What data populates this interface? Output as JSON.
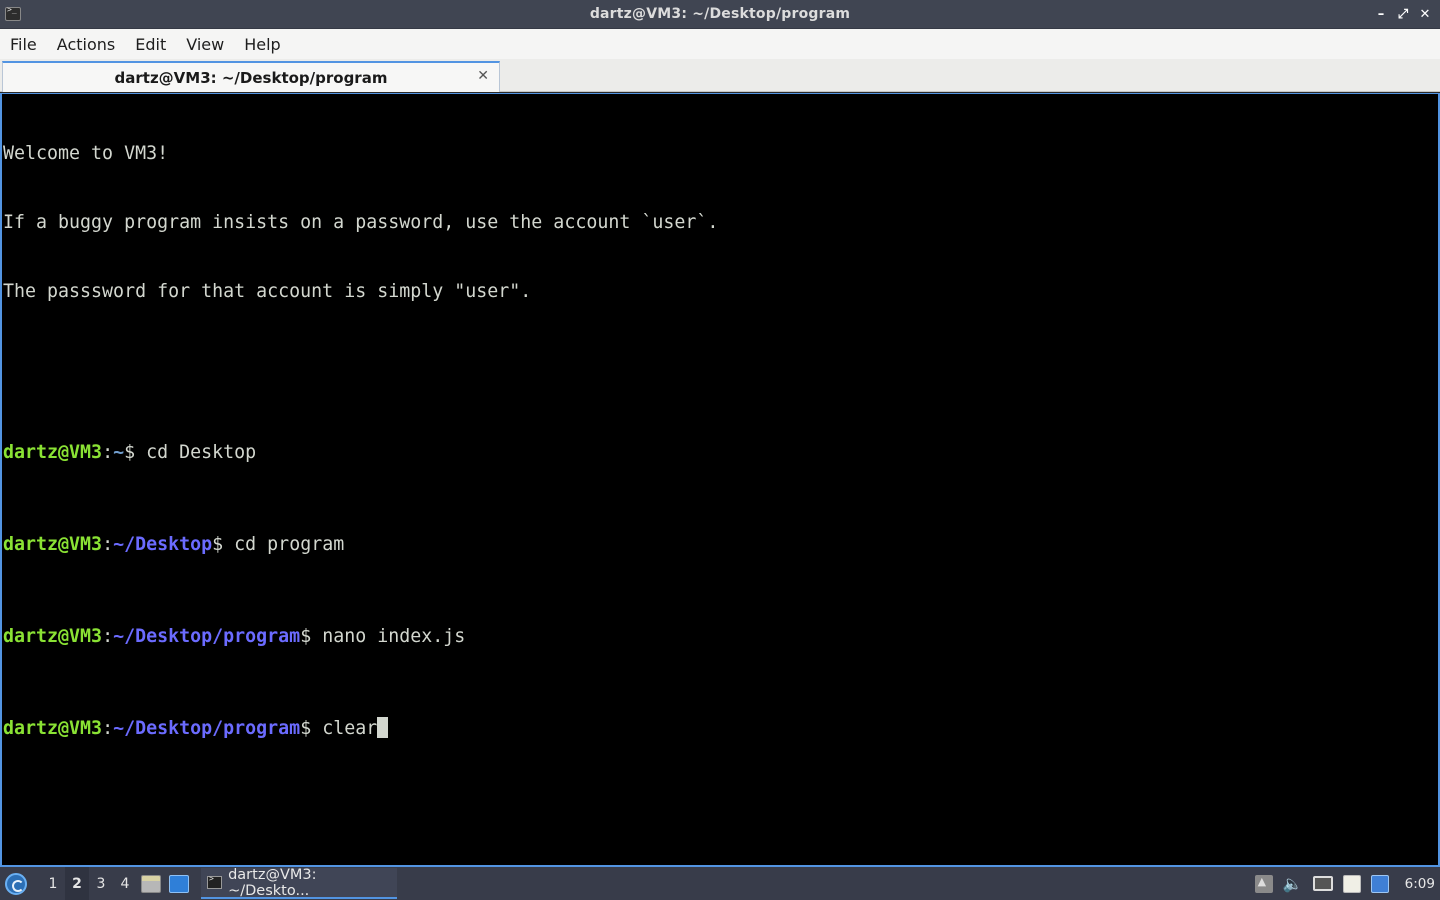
{
  "window": {
    "title": "dartz@VM3: ~/Desktop/program",
    "minimize_glyph": "–",
    "maximize_glyph": "⤢",
    "close_glyph": "✕"
  },
  "menu": {
    "items": [
      "File",
      "Actions",
      "Edit",
      "View",
      "Help"
    ]
  },
  "tabs": [
    {
      "label": "dartz@VM3: ~/Desktop/program",
      "close_glyph": "✕"
    }
  ],
  "terminal": {
    "motd": [
      "Welcome to VM3!",
      "If a buggy program insists on a password, use the account `user`.",
      "The passsword for that account is simply \"user\"."
    ],
    "prompt_user": "dartz@VM3",
    "prompt_sep": ":",
    "commands": [
      {
        "path": "~",
        "cmd": " cd Desktop"
      },
      {
        "path": "~/Desktop",
        "cmd": " cd program"
      },
      {
        "path": "~/Desktop/program",
        "cmd": " nano index.js"
      },
      {
        "path": "~/Desktop/program",
        "cmd": " clear"
      }
    ],
    "dollar": "$"
  },
  "taskbar": {
    "workspaces": [
      "1",
      "2",
      "3",
      "4"
    ],
    "active_workspace": "2",
    "task_label": "dartz@VM3: ~/Deskto...",
    "clock": "6:09",
    "volume_glyph": "🔈"
  },
  "colors": {
    "accent": "#5294e2",
    "prompt_user": "#8ae234",
    "prompt_path": "#729fcf"
  }
}
